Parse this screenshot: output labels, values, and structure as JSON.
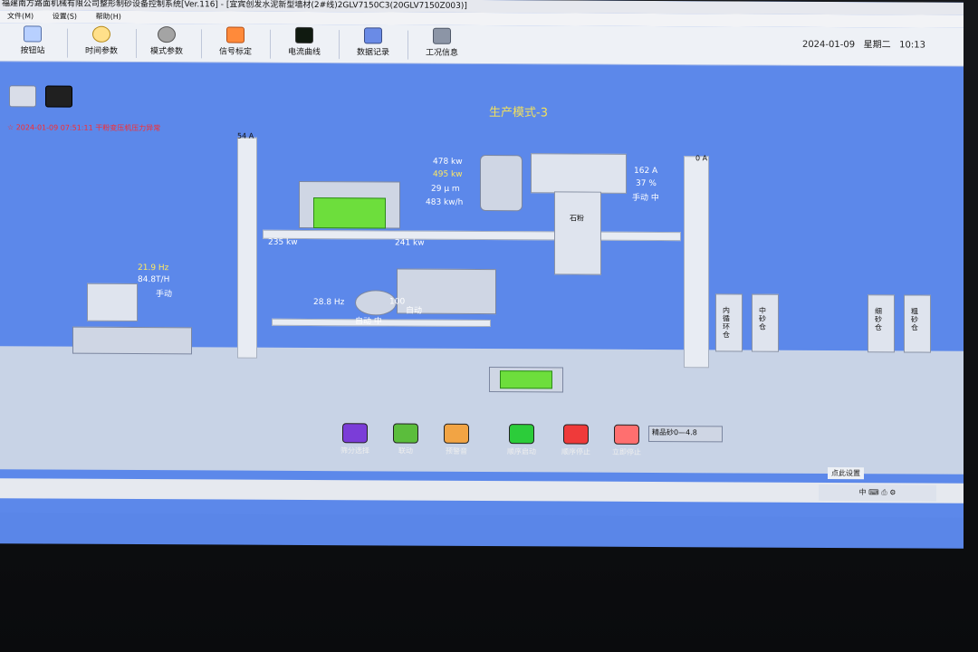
{
  "window": {
    "title": "福建南方路面机械有限公司整形制砂设备控制系统[Ver.116] - [宜宾创发水泥新型墙材(2#线)2GLV7150C3(20GLV7150Z003)]"
  },
  "menu": {
    "items": [
      "文件(M)",
      "设置(S)",
      "帮助(H)"
    ]
  },
  "toolbar": {
    "buttons": [
      {
        "label": "按钮站"
      },
      {
        "label": "时间参数"
      },
      {
        "label": "模式参数"
      },
      {
        "label": "信号标定"
      },
      {
        "label": "电流曲线"
      },
      {
        "label": "数据记录"
      },
      {
        "label": "工况信息"
      }
    ]
  },
  "header": {
    "date": "2024-01-09",
    "weekday": "星期二",
    "time": "10:13"
  },
  "main": {
    "mode_title": "生产模式-3",
    "alarm": "☆ 2024-01-09 07:51:11 干粉变压机压力异常",
    "labels": {
      "elevator_left": "54 A",
      "elevator_right": "0 A",
      "power1": "478 kw",
      "power2": "495 kw",
      "micron": "29 μ m",
      "energy": "483 kw/h",
      "current_motor_left": "235 kw",
      "current_motor_right": "241 kw",
      "freq_feeder": "21.9 Hz",
      "feed_rate": "84.8T/H",
      "manual": "手动",
      "freq_fan": "28.8 Hz",
      "auto_mid": "自动 中",
      "auto": "自动",
      "auto_mid_val": "100",
      "current_right": "162 A",
      "percent_right": "37 %",
      "manual_mid": "手动 中",
      "silo_mid1": "内循环仓",
      "silo_mid2": "中砂仓",
      "silo_right1": "细砂仓",
      "silo_right2": "粗砂仓",
      "product_belt": "精品砂0—4.8",
      "ash_bin": "石粉"
    }
  },
  "controls": [
    {
      "label": "筛分选择"
    },
    {
      "label": "联动"
    },
    {
      "label": "预警音"
    },
    {
      "label": "顺序启动"
    },
    {
      "label": "顺序停止"
    },
    {
      "label": "立即停止"
    }
  ],
  "statusbar": {
    "settings_hint": "点此设置",
    "tray": "中 ⌨ ⎙ ⚙"
  }
}
